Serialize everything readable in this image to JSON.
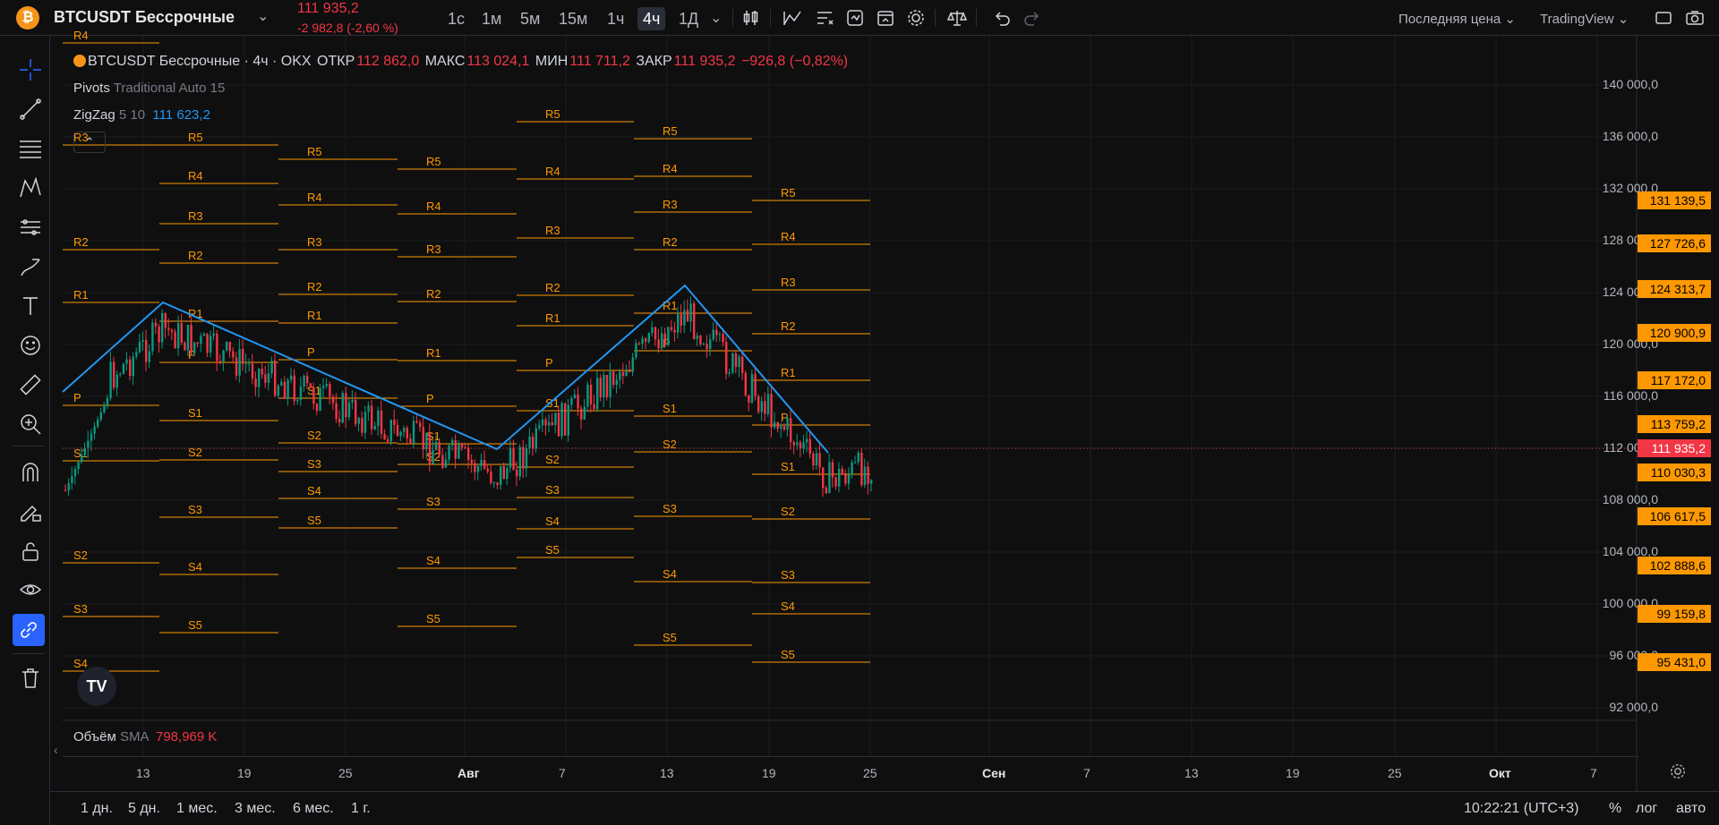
{
  "header": {
    "symbol_logo": "₿",
    "symbol": "BTCUSDT Бессрочные",
    "price": "111 935,2",
    "change": "-2 982,8 (-2,60 %)",
    "timeframes": [
      "1с",
      "1м",
      "5м",
      "15м",
      "1ч",
      "4ч",
      "1Д"
    ],
    "active_timeframe": "4ч",
    "price_source": "Последняя цена",
    "data_vendor": "TradingView"
  },
  "legend": {
    "title": "BTCUSDT Бессрочные · 4ч · OKX",
    "open_label": "ОТКР",
    "open": "112 862,0",
    "high_label": "МАКС",
    "high": "113 024,1",
    "low_label": "МИН",
    "low": "111 711,2",
    "close_label": "ЗАКР",
    "close": "111 935,2",
    "change": "−926,8 (−0,82%)"
  },
  "indicators": {
    "pivots_name": "Pivots",
    "pivots_params": "Traditional Auto 15",
    "zigzag_name": "ZigZag",
    "zigzag_params": "5 10",
    "zigzag_value": "111 623,2",
    "collapse_glyph": "⌃"
  },
  "volume": {
    "name": "Объём",
    "ma": "SMA",
    "value": "798,969 K"
  },
  "yaxis": {
    "labels": [
      "140 000,0",
      "136 000,0",
      "132 000,0",
      "128 000,0",
      "124 000,0",
      "120 000,0",
      "116 000,0",
      "112 000,0",
      "108 000,0",
      "104 000,0",
      "100 000,0",
      "96 000,0",
      "92 000,0"
    ],
    "pivot_tags": [
      "131 139,5",
      "127 726,6",
      "124 313,7",
      "120 900,9",
      "117 172,0",
      "113 759,2",
      "110 030,3",
      "106 617,5",
      "102 888,6",
      "99 159,8",
      "95 431,0"
    ],
    "current_tag": "111 935,2",
    "colors": {
      "pivot": "#ff9800",
      "current": "#f23645",
      "zigzag": "#2196f3",
      "up": "#089981",
      "down": "#f23645"
    }
  },
  "xaxis": {
    "labels": [
      "13",
      "19",
      "25",
      "Авг",
      "7",
      "13",
      "19",
      "25",
      "Сен",
      "7",
      "13",
      "19",
      "25",
      "Окт",
      "7"
    ]
  },
  "pivot_labels": {
    "p1": [
      "R4",
      "R3",
      "R2",
      "R1",
      "P",
      "S1",
      "S2",
      "S3",
      "S4"
    ],
    "p2": [
      "R5",
      "R4",
      "R3",
      "R2",
      "R1",
      "P",
      "S1",
      "S2",
      "S3",
      "S4",
      "S5"
    ],
    "p3": [
      "R5",
      "R4",
      "R3",
      "R2",
      "R1",
      "P",
      "S1",
      "S2",
      "S3",
      "S4",
      "S5"
    ],
    "p4": [
      "R5",
      "R4",
      "R3",
      "R2",
      "R1",
      "P",
      "S1",
      "S2",
      "S3",
      "S4",
      "S5"
    ],
    "p5": [
      "R5",
      "R4",
      "R3",
      "R2",
      "R1",
      "P",
      "S1",
      "S2",
      "S3",
      "S4",
      "S5"
    ],
    "p6": [
      "R5",
      "R4",
      "R3",
      "R2",
      "R1",
      "P",
      "S1",
      "S2",
      "S3",
      "S4",
      "S5"
    ],
    "p7": [
      "R5",
      "R4",
      "R3",
      "R2",
      "R1",
      "P",
      "S1",
      "S2",
      "S3",
      "S4",
      "S5"
    ]
  },
  "bottom": {
    "ranges": [
      "1 дн.",
      "5 дн.",
      "1 мес.",
      "3 мес.",
      "6 мес.",
      "1 г."
    ],
    "clock": "10:22:21 (UTC+3)",
    "percent": "%",
    "log": "лог",
    "auto": "авто"
  }
}
